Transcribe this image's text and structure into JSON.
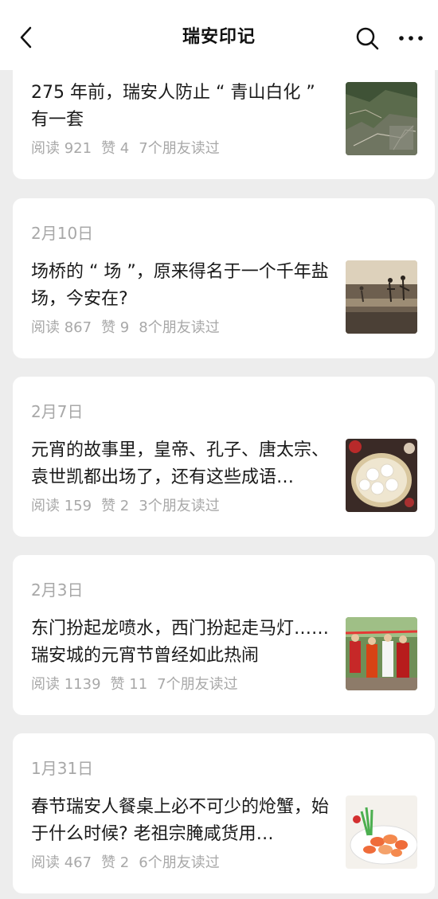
{
  "header": {
    "title": "瑞安印记"
  },
  "articles": [
    {
      "date": "",
      "title": "275 年前，瑞安人防止 “ 青山白化 ” 有一套",
      "reads": "阅读 921",
      "likes": "赞 4",
      "friends": "7个朋友读过",
      "thumbnail": "satellite-map-image"
    },
    {
      "date": "2月10日",
      "title": "场桥的 “ 场 ”，原来得名于一个千年盐场，今安在?",
      "reads": "阅读 867",
      "likes": "赞 9",
      "friends": "8个朋友读过",
      "thumbnail": "salt-field-workers-image"
    },
    {
      "date": "2月7日",
      "title": "元宵的故事里，皇帝、孔子、唐太宗、袁世凯都出场了，还有这些成语…",
      "reads": "阅读 159",
      "likes": "赞 2",
      "friends": "3个朋友读过",
      "thumbnail": "tangyuan-bowl-image"
    },
    {
      "date": "2月3日",
      "title": "东门扮起龙喷水，西门扮起走马灯……瑞安城的元宵节曾经如此热闹",
      "reads": "阅读 1139",
      "likes": "赞 11",
      "friends": "7个朋友读过",
      "thumbnail": "festival-parade-image"
    },
    {
      "date": "1月31日",
      "title": "春节瑞安人餐桌上必不可少的炝蟹，始于什么时候? 老祖宗腌咸货用…",
      "reads": "阅读 467",
      "likes": "赞 2",
      "friends": "6个朋友读过",
      "thumbnail": "crab-dish-image"
    }
  ]
}
